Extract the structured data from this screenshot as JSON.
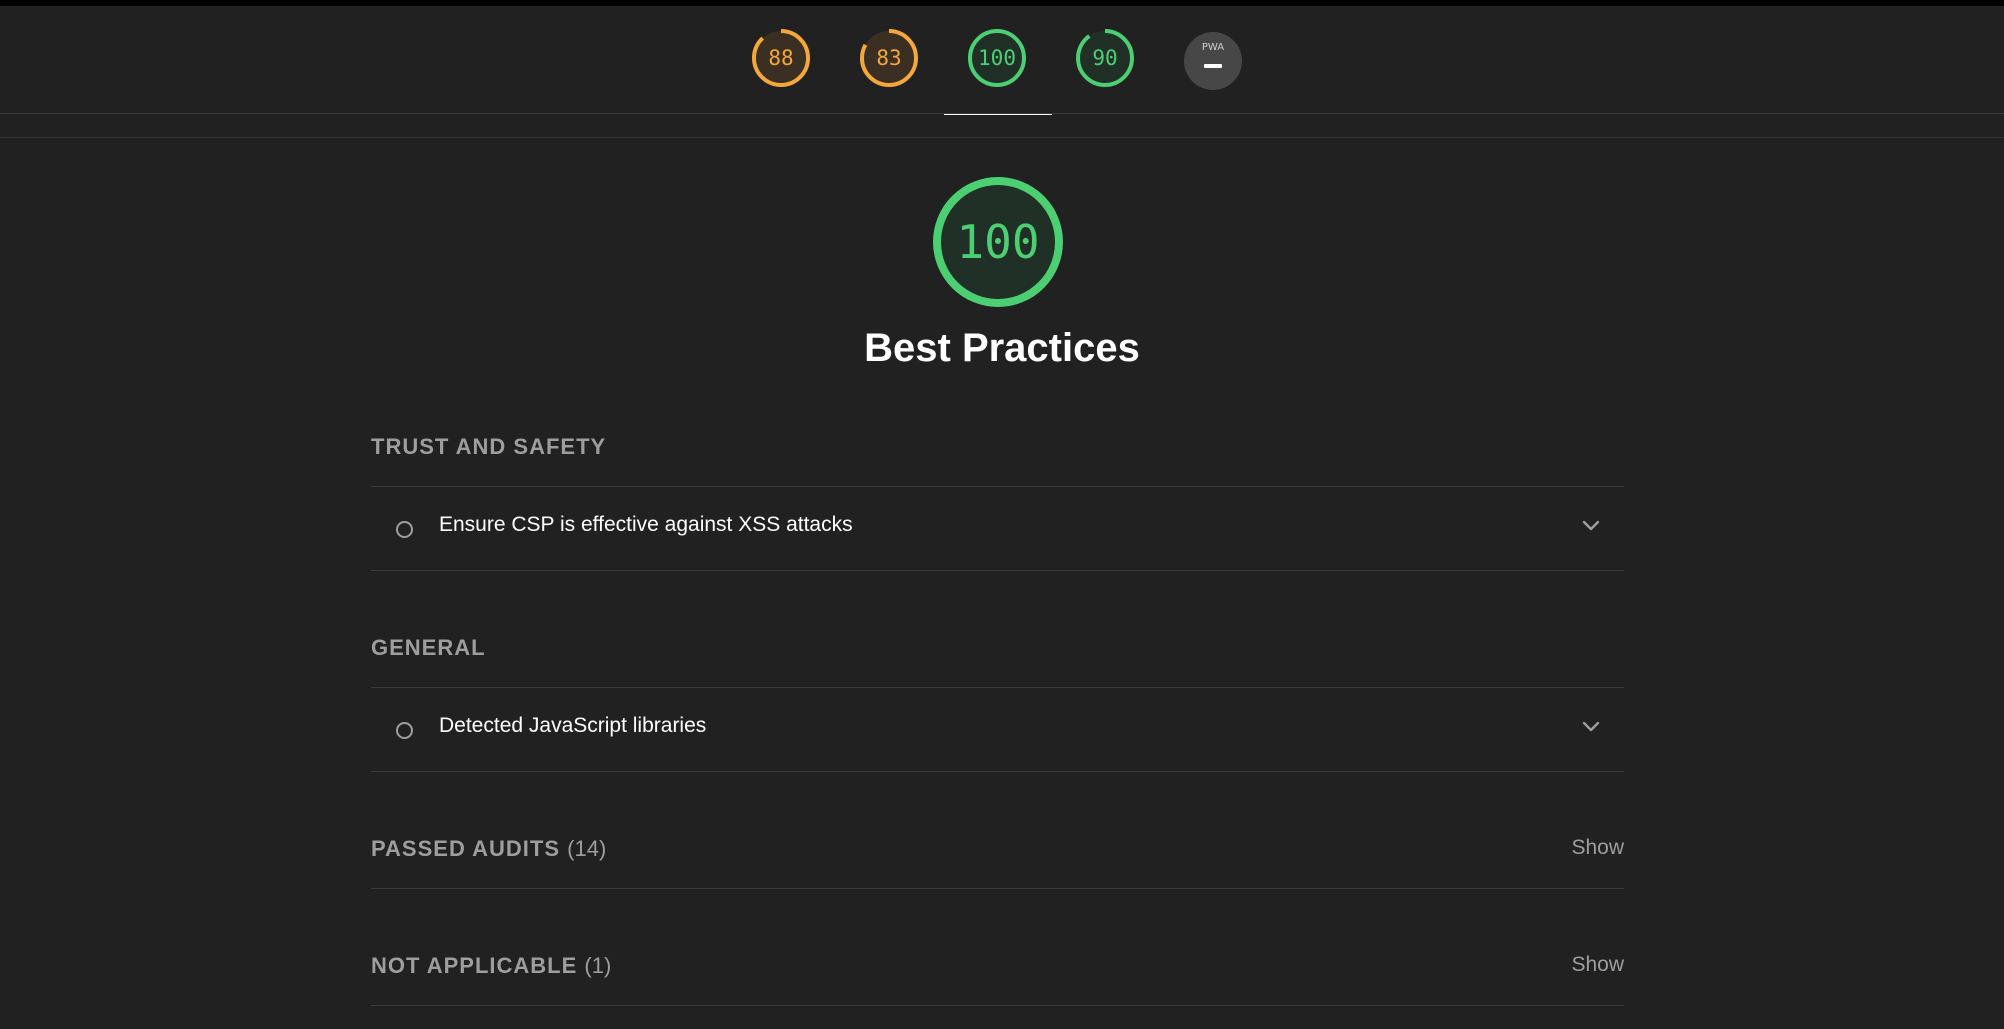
{
  "nav": {
    "gauges": [
      {
        "score": "88",
        "value": 88,
        "color": "#f5a83a",
        "fill": "#3a2f22"
      },
      {
        "score": "83",
        "value": 83,
        "color": "#f5a83a",
        "fill": "#3a2f22"
      },
      {
        "score": "100",
        "value": 100,
        "color": "#4cce73",
        "fill": "#203026"
      },
      {
        "score": "90",
        "value": 90,
        "color": "#4cce73",
        "fill": "#203026"
      }
    ],
    "pwa_label": "PWA",
    "active_index": 2
  },
  "category": {
    "score": "100",
    "value": 100,
    "title": "Best Practices",
    "color": "#4cce73"
  },
  "sections": {
    "trust": {
      "heading": "TRUST AND SAFETY",
      "audit_title": "Ensure CSP is effective against XSS attacks"
    },
    "general": {
      "heading": "GENERAL",
      "audit_title": "Detected JavaScript libraries"
    },
    "passed": {
      "heading": "PASSED AUDITS",
      "count": "(14)",
      "show_label": "Show"
    },
    "not_applicable": {
      "heading": "NOT APPLICABLE",
      "count": "(1)",
      "show_label": "Show"
    }
  }
}
